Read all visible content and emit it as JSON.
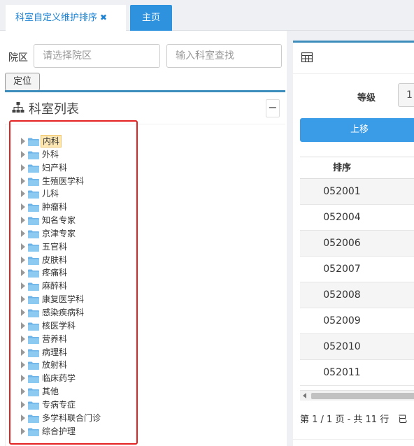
{
  "tabs": {
    "active_label": "科室自定义维护排序",
    "close_glyph": "✖",
    "home_label": "主页"
  },
  "filters": {
    "campus_label": "院区",
    "campus_placeholder": "请选择院区",
    "dept_placeholder": "输入科室查找",
    "locate_button": "定位"
  },
  "dept_panel": {
    "title": "科室列表",
    "collapse_glyph": "−",
    "selected_index": 0,
    "items": [
      "内科",
      "外科",
      "妇产科",
      "生殖医学科",
      "儿科",
      "肿瘤科",
      "知名专家",
      "京津专家",
      "五官科",
      "皮肤科",
      "疼痛科",
      "麻醉科",
      "康复医学科",
      "感染疾病科",
      "核医学科",
      "营养科",
      "病理科",
      "放射科",
      "临床药学",
      "其他",
      "专病专症",
      "多学科联合门诊",
      "综合护理"
    ]
  },
  "sort_panel": {
    "level_label": "等级",
    "level_value": "1",
    "move_up_button": "上移",
    "column_header": "排序",
    "rows": [
      "052001",
      "052004",
      "052006",
      "052007",
      "052008",
      "052009",
      "052010",
      "052011"
    ],
    "pager_text": "第 1 / 1 页 - 共 11 行　已"
  },
  "colors": {
    "accent": "#3c8dbc",
    "tab_home_bg": "#2e92de",
    "button_blue": "#3a9be6",
    "highlight_box": "#e42222",
    "folder": "#6cb4e8"
  },
  "icons": {
    "tree_icon": "sitemap-icon",
    "folder_icon": "folder-icon",
    "grid_icon": "table-grid-icon"
  }
}
